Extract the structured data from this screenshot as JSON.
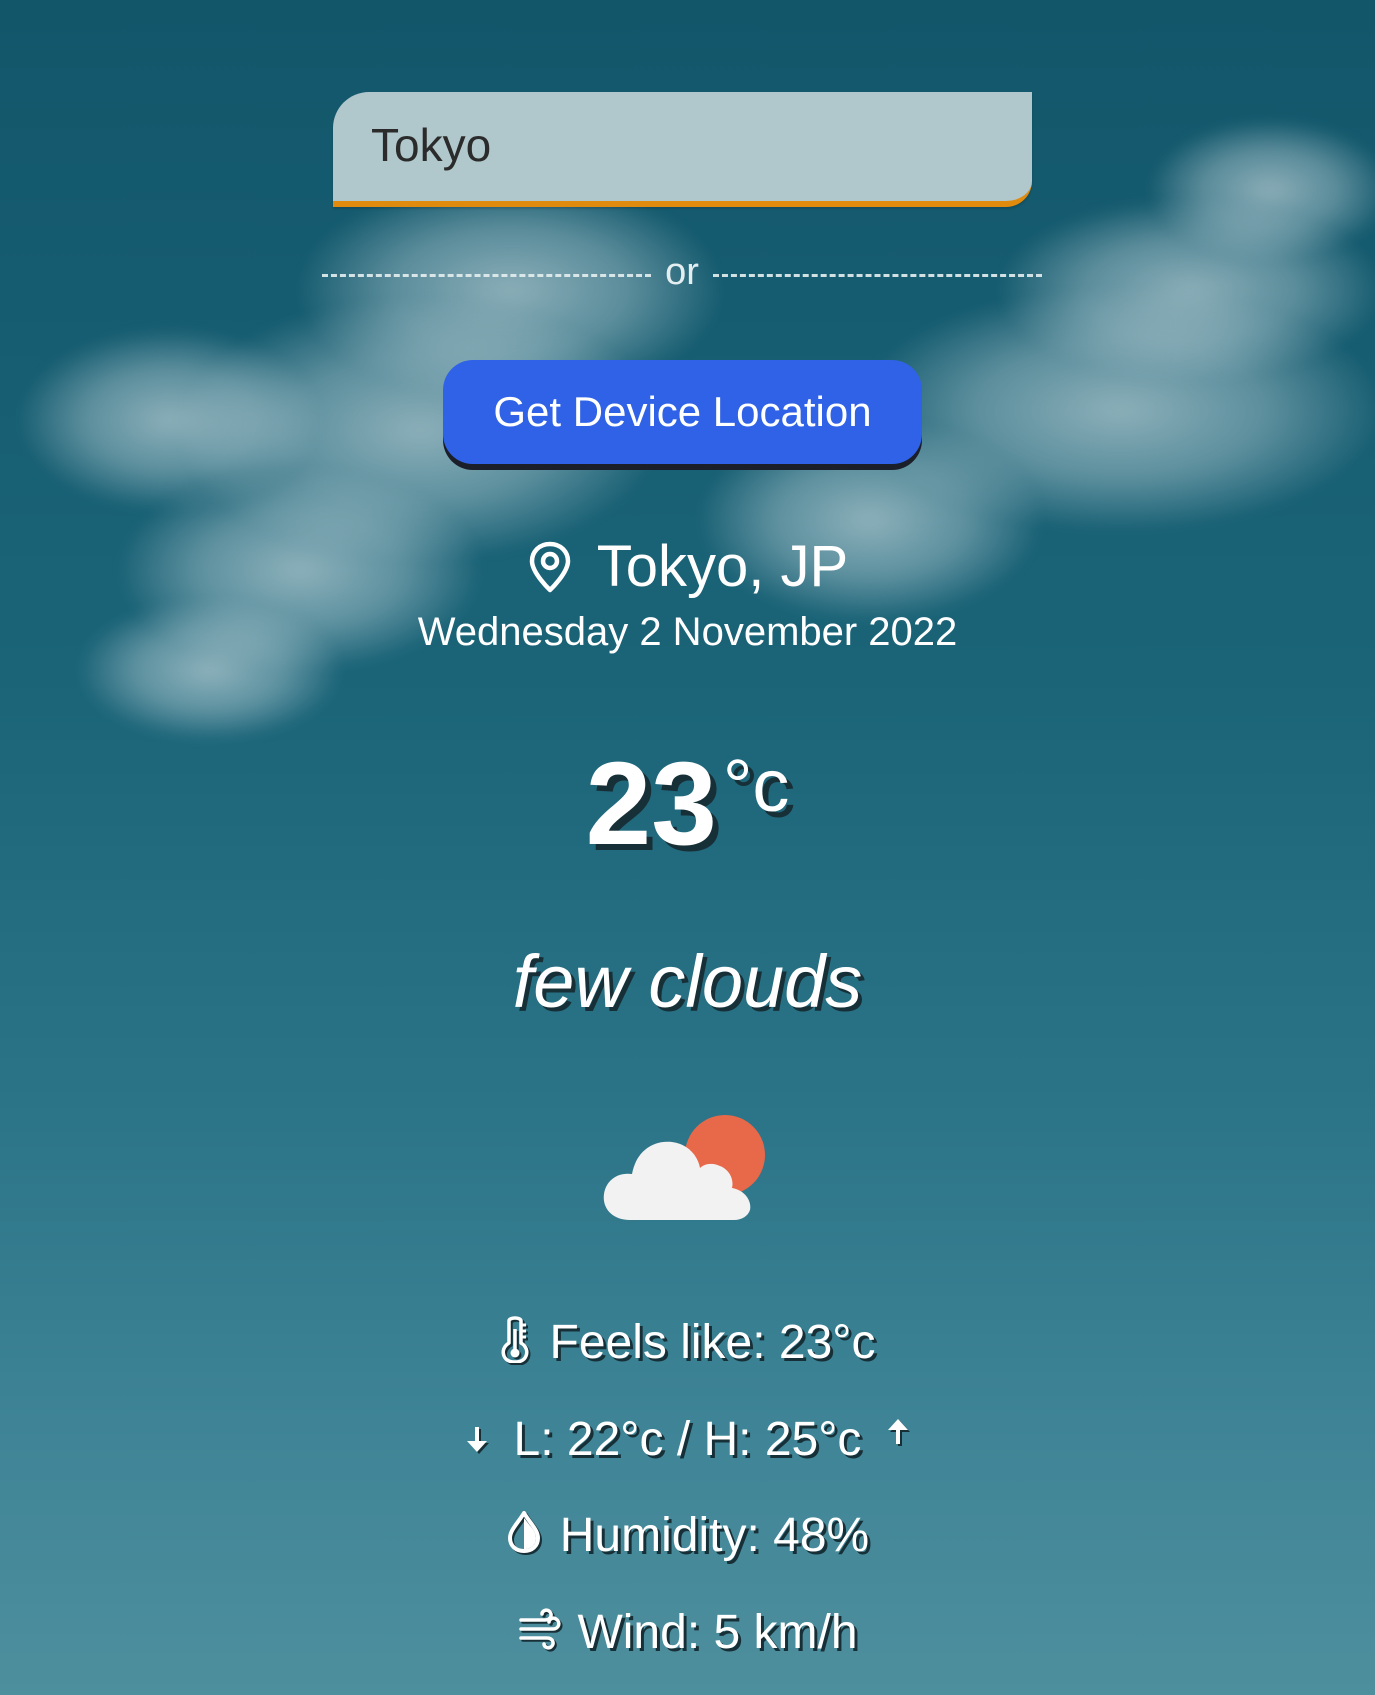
{
  "search": {
    "value": "Tokyo",
    "placeholder": ""
  },
  "divider_label": "or",
  "location_button_label": "Get Device Location",
  "location": {
    "city": "Tokyo, JP",
    "date": "Wednesday 2 November 2022",
    "icon": "map-pin-icon"
  },
  "weather": {
    "temperature": "23",
    "unit": "°c",
    "description": "few clouds",
    "icon": "few-clouds-day-icon"
  },
  "details": {
    "feels_like": "Feels like: 23°c",
    "low_high": "L: 22°c / H: 25°c",
    "humidity": "Humidity: 48%",
    "wind": "Wind: 5 km/h"
  },
  "icons": {
    "feels_like": "thermometer-icon",
    "low": "arrow-down-icon",
    "high": "arrow-up-icon",
    "humidity": "droplet-icon",
    "wind": "wind-icon"
  },
  "colors": {
    "button": "#2f62e6",
    "input_border": "#e08b0e",
    "input_bg": "#b0c7cb",
    "sun": "#e8694a",
    "cloud": "#f2f2f2"
  }
}
